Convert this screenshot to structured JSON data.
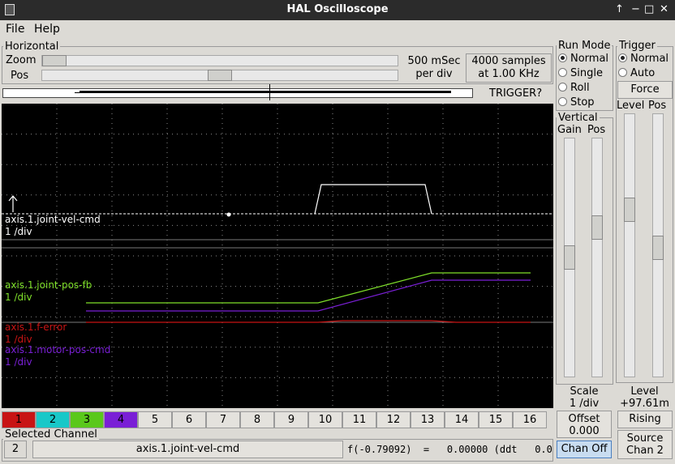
{
  "window": {
    "title": "HAL Oscilloscope",
    "controls": [
      "↑",
      "−",
      "□",
      "✕"
    ]
  },
  "menu": {
    "file": "File",
    "help": "Help"
  },
  "horizontal": {
    "group_label": "Horizontal",
    "zoom_label": "Zoom",
    "pos_label": "Pos",
    "time_div": "500 mSec",
    "per_div": "per div",
    "samples": "4000 samples",
    "rate": "at 1.00 KHz",
    "trigger_status": "TRIGGER?",
    "zoom_value": 0.0,
    "pos_value": 0.5
  },
  "run_mode": {
    "group_label": "Run Mode",
    "options": [
      "Normal",
      "Single",
      "Roll",
      "Stop"
    ],
    "selected": "Normal"
  },
  "trigger": {
    "group_label": "Trigger",
    "options": [
      "Normal",
      "Auto"
    ],
    "selected": "Normal",
    "force": "Force",
    "level_label": "Level",
    "pos_label": "Pos",
    "level_readout_label": "Level",
    "level_readout_value": "+97.61m",
    "edge": "Rising",
    "source_label": "Source",
    "source_chan": "Chan  2"
  },
  "vertical": {
    "group_label": "Vertical",
    "gain_label": "Gain",
    "pos_label": "Pos",
    "scale_label": "Scale",
    "scale_value": "1 /div",
    "offset_label": "Offset",
    "offset_value": "0.000",
    "chan_off": "Chan Off"
  },
  "traces": [
    {
      "name": "axis.1.joint-vel-cmd",
      "scale": "1 /div",
      "color": "#ffffff"
    },
    {
      "name": "axis.1.joint-pos-fb",
      "scale": "1 /div",
      "color": "#7fe02a"
    },
    {
      "name": "axis.1.f-error",
      "scale": "1 /div",
      "color": "#c81414"
    },
    {
      "name": "axis.1.motor-pos-cmd",
      "scale": "1 /div",
      "color": "#7a1fd6"
    }
  ],
  "channels": [
    {
      "label": "1",
      "color": "#c81414"
    },
    {
      "label": "2",
      "color": "#18c8c8"
    },
    {
      "label": "3",
      "color": "#5ac81a"
    },
    {
      "label": "4",
      "color": "#7a1fd6"
    },
    {
      "label": "5"
    },
    {
      "label": "6"
    },
    {
      "label": "7"
    },
    {
      "label": "8"
    },
    {
      "label": "9"
    },
    {
      "label": "10"
    },
    {
      "label": "11"
    },
    {
      "label": "12"
    },
    {
      "label": "13"
    },
    {
      "label": "14"
    },
    {
      "label": "15"
    },
    {
      "label": "16"
    }
  ],
  "selected_channel": {
    "group_label": "Selected Channel",
    "number": "2",
    "name": "axis.1.joint-vel-cmd",
    "readout": "f(-0.79092)  =   0.00000 (ddt   0.0"
  }
}
